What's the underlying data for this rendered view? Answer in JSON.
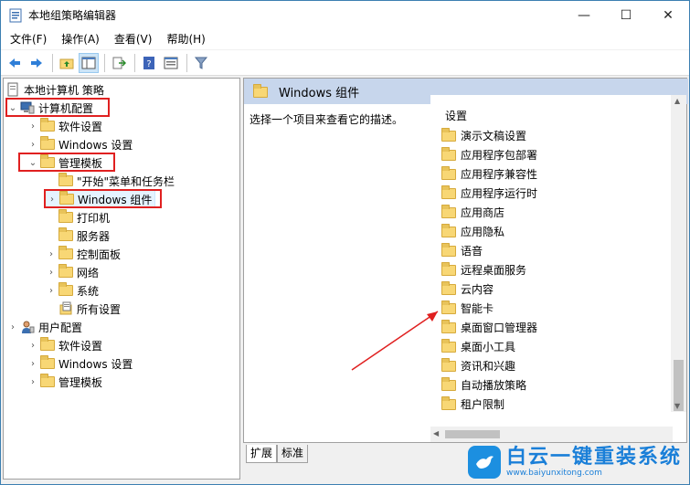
{
  "window": {
    "title": "本地组策略编辑器",
    "minimize": "—",
    "maximize": "☐",
    "close": "✕"
  },
  "menu": {
    "items": [
      "文件(F)",
      "操作(A)",
      "查看(V)",
      "帮助(H)"
    ]
  },
  "toolbar": {
    "icons": [
      "back-icon",
      "forward-icon",
      "up-folder-icon",
      "show-tree-icon",
      "export-icon",
      "help-icon",
      "properties-icon",
      "filter-icon"
    ]
  },
  "tree": {
    "root": "本地计算机 策略",
    "computer_config": "计算机配置",
    "software_settings": "软件设置",
    "windows_settings": "Windows 设置",
    "admin_templates": "管理模板",
    "start_menu": "\"开始\"菜单和任务栏",
    "windows_components": "Windows 组件",
    "printers": "打印机",
    "server": "服务器",
    "control_panel": "控制面板",
    "network": "网络",
    "system": "系统",
    "all_settings": "所有设置",
    "user_config": "用户配置",
    "user_software_settings": "软件设置",
    "user_windows_settings": "Windows 设置",
    "user_admin_templates": "管理模板"
  },
  "right": {
    "header_title": "Windows 组件",
    "description": "选择一个项目来查看它的描述。",
    "column_header": "设置",
    "items": [
      "演示文稿设置",
      "应用程序包部署",
      "应用程序兼容性",
      "应用程序运行时",
      "应用商店",
      "应用隐私",
      "语音",
      "远程桌面服务",
      "云内容",
      "智能卡",
      "桌面窗口管理器",
      "桌面小工具",
      "资讯和兴趣",
      "自动播放策略",
      "租户限制"
    ]
  },
  "tabs": {
    "extended": "扩展",
    "standard": "标准"
  },
  "watermark": {
    "title": "白云一键重装系统",
    "url": "www.baiyunxitong.com"
  },
  "colors": {
    "accent": "#3c7fb1",
    "header_bg": "#c7d6ec",
    "annotation": "#e02020",
    "folder": "#f8d775"
  }
}
